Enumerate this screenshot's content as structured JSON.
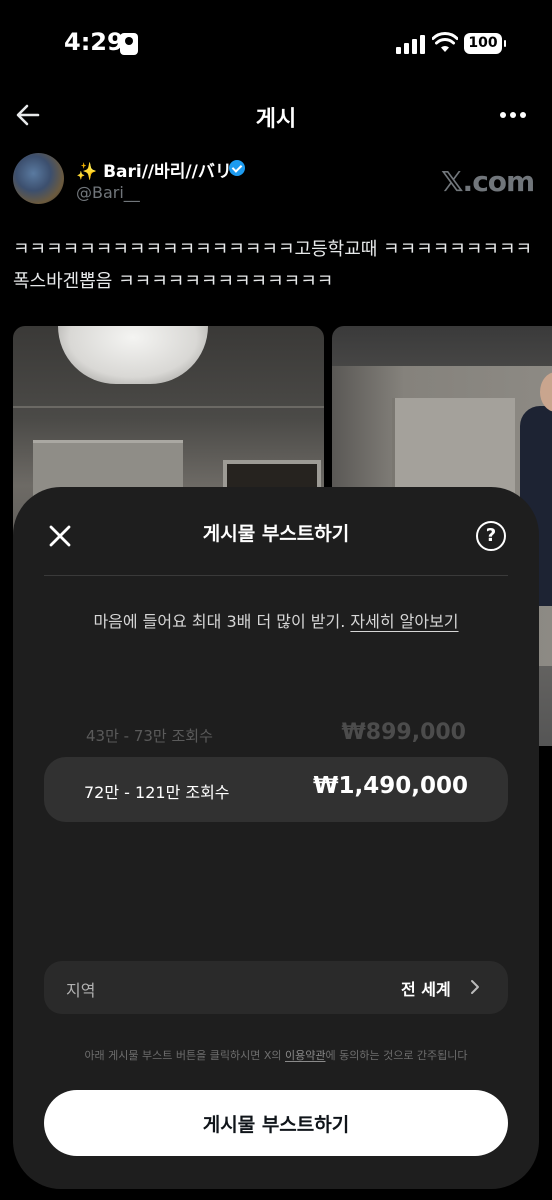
{
  "status_bar": {
    "time": "4:29",
    "battery": "100"
  },
  "header": {
    "title": "게시"
  },
  "post": {
    "author_name": "✨ Bari//바리//バリ",
    "author_handle": "@Bari__",
    "source_logo": "𝕏.com",
    "text": "ㅋㅋㅋㅋㅋㅋㅋㅋㅋㅋㅋㅋㅋㅋㅋㅋㅋ고등학교때 ㅋㅋㅋㅋㅋㅋㅋㅋㅋ폭스바겐뽑음 ㅋㅋㅋㅋㅋㅋㅋㅋㅋㅋㅋㅋㅋ"
  },
  "boost_sheet": {
    "title": "게시물 부스트하기",
    "subtitle": "마음에 들어요 최대 3배 더 많이 받기.",
    "learn_more": "자세히 알아보기",
    "options": [
      {
        "views": "43만 - 73만 조회수",
        "price": "₩899,000",
        "selected": false
      },
      {
        "views": "72만 - 121만 조회수",
        "price": "₩1,490,000",
        "selected": true
      }
    ],
    "region": {
      "label": "지역",
      "value": "전 세계"
    },
    "terms": {
      "prefix": "아래 게시물 부스트 버튼을 클릭하시면 X의 ",
      "link": "이용약관",
      "suffix": "에 동의하는 것으로 간주됩니다"
    },
    "button_label": "게시물 부스트하기"
  },
  "icons": {
    "back": "arrow-left-icon",
    "more": "more-horizontal-icon",
    "verified": "verified-badge-icon",
    "close": "close-icon",
    "help": "question-circle-icon",
    "chevron": "chevron-right-icon"
  },
  "colors": {
    "accent_verified": "#1d9bf0",
    "sheet_bg": "#1e1e1e",
    "button_bg": "#ffffff"
  }
}
